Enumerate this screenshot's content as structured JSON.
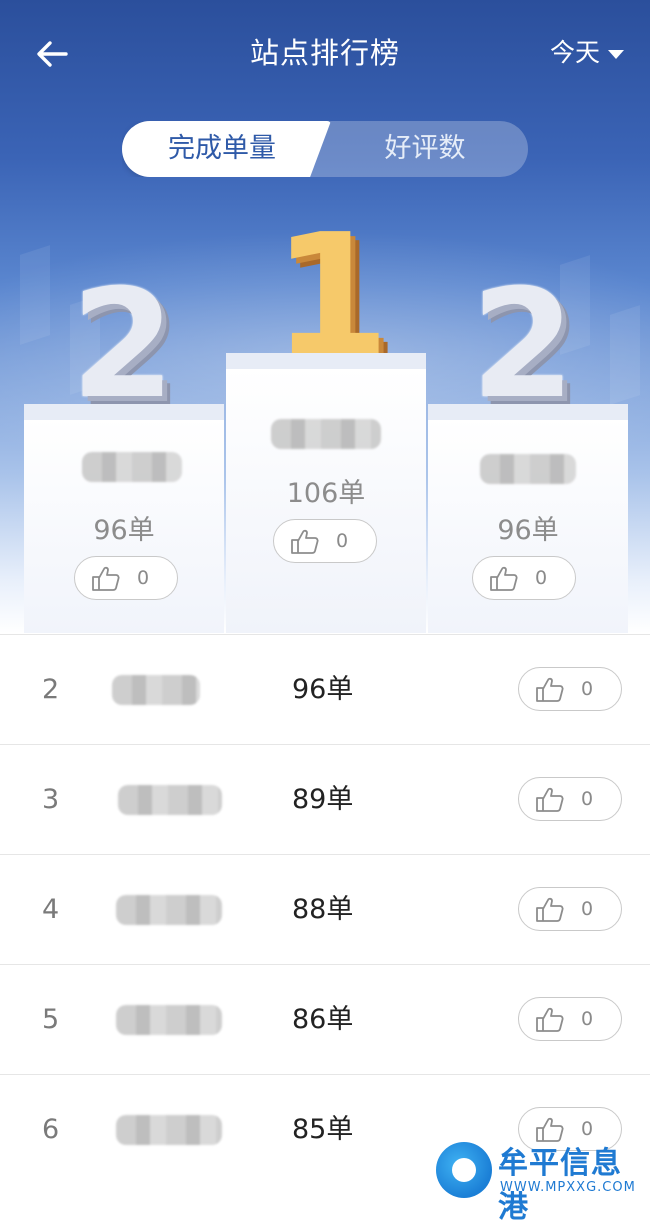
{
  "header": {
    "title": "站点排行榜",
    "period": "今天"
  },
  "tabs": [
    {
      "label": "完成单量",
      "active": true
    },
    {
      "label": "好评数",
      "active": false
    }
  ],
  "podium": [
    {
      "rank_label": "2",
      "count": "96单",
      "likes": "0"
    },
    {
      "rank_label": "1",
      "count": "106单",
      "likes": "0"
    },
    {
      "rank_label": "2",
      "count": "96单",
      "likes": "0"
    }
  ],
  "list": [
    {
      "rank": "2",
      "count": "96单",
      "likes": "0"
    },
    {
      "rank": "3",
      "count": "89单",
      "likes": "0"
    },
    {
      "rank": "4",
      "count": "88单",
      "likes": "0"
    },
    {
      "rank": "5",
      "count": "86单",
      "likes": "0"
    },
    {
      "rank": "6",
      "count": "85单",
      "likes": "0"
    }
  ],
  "watermark": {
    "name": "牟平信息港",
    "url": "WWW.MPXXG.COM"
  },
  "colors": {
    "accent": "#2f5aa8",
    "header_bg": "#2b4f9c"
  },
  "icons": {
    "back": "arrow-left-icon",
    "dropdown": "caret-down-icon",
    "like": "thumbs-up-icon"
  }
}
